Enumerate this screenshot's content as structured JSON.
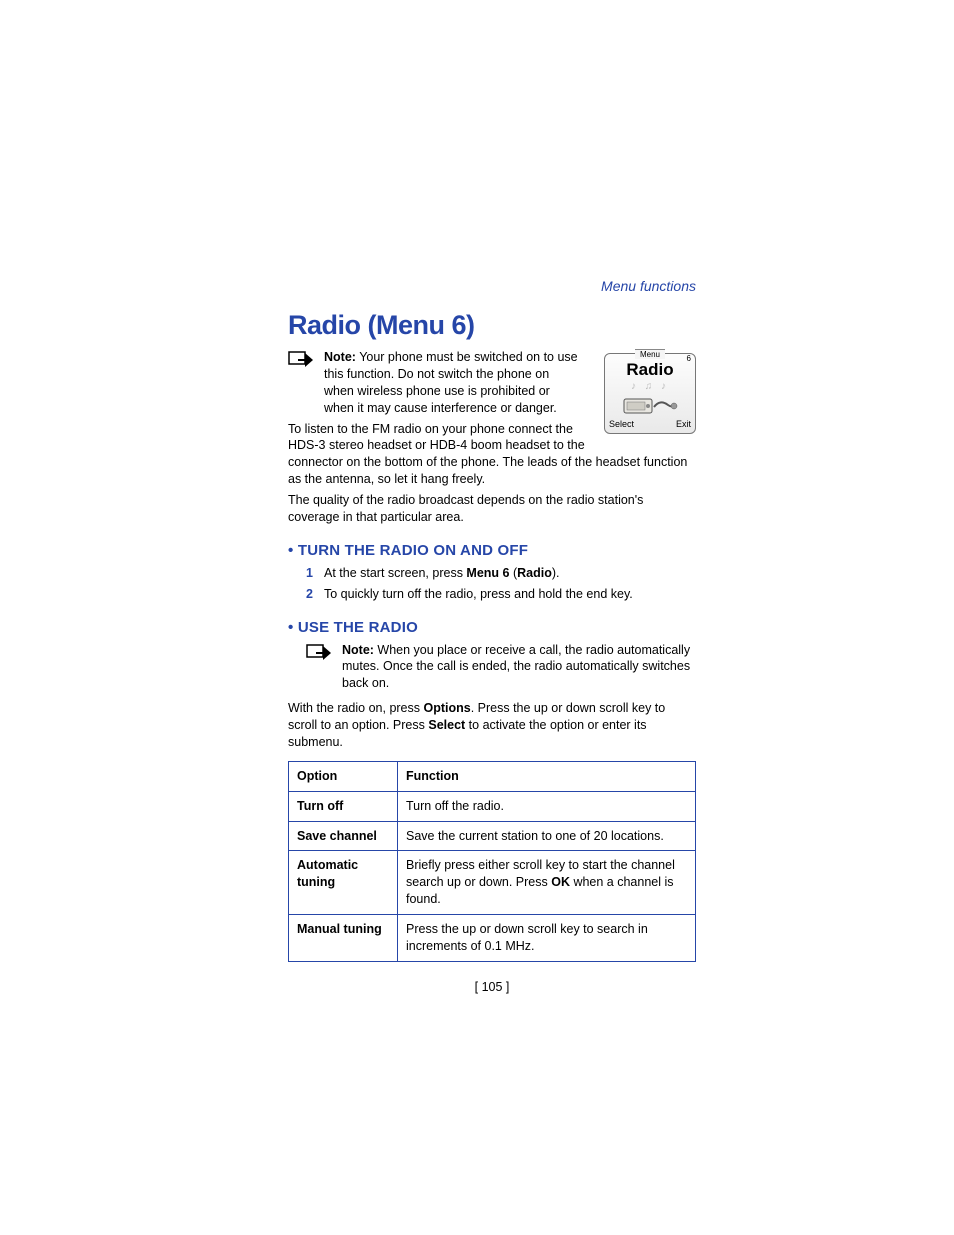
{
  "breadcrumb": "Menu functions",
  "title": "Radio (Menu 6)",
  "note1": {
    "label": "Note:",
    "text": " Your phone must be switched on to use this function. Do not switch the phone on when wireless phone use is prohibited or when it may cause interference or danger."
  },
  "phone": {
    "menu_label": "Menu",
    "menu_num": "6",
    "title": "Radio",
    "notes_glyphs": "♪ ♫ ♪",
    "left_softkey": "Select",
    "right_softkey": "Exit"
  },
  "para1": "To listen to the FM radio on your phone connect the HDS-3 stereo headset or HDB-4 boom headset to the connector on the bottom of the phone. The leads of the headset function as the antenna, so let it hang freely.",
  "para2": " The quality of the radio broadcast depends on the radio station's coverage in that particular area.",
  "section1": {
    "heading": "TURN THE RADIO ON AND OFF",
    "steps": [
      {
        "num": "1",
        "pre": "At the start screen, press ",
        "b1": "Menu 6",
        "mid": " (",
        "b2": "Radio",
        "post": ")."
      },
      {
        "num": "2",
        "pre": "To quickly turn off the radio, press and hold the end key.",
        "b1": "",
        "mid": "",
        "b2": "",
        "post": ""
      }
    ]
  },
  "section2": {
    "heading": "USE THE RADIO",
    "note": {
      "label": "Note:",
      "text": " When you place or receive a call, the radio automatically mutes. Once the call is ended, the radio automatically switches back on."
    },
    "para_pre": "With the radio on, press ",
    "para_b1": "Options",
    "para_mid": ". Press the up or down scroll key to scroll to an option. Press ",
    "para_b2": "Select",
    "para_post": " to activate the option or enter its submenu."
  },
  "table": {
    "headers": {
      "c1": "Option",
      "c2": "Function"
    },
    "rows": [
      {
        "opt": "Turn off",
        "func_pre": "Turn off the radio.",
        "func_b": "",
        "func_post": ""
      },
      {
        "opt": "Save channel",
        "func_pre": "Save the current station to one of 20 locations.",
        "func_b": "",
        "func_post": ""
      },
      {
        "opt": "Automatic tuning",
        "func_pre": "Briefly press either scroll key to start the channel search up or down. Press ",
        "func_b": "OK",
        "func_post": " when a channel is found."
      },
      {
        "opt": "Manual tuning",
        "func_pre": "Press the up or down scroll key to search in increments of 0.1 MHz.",
        "func_b": "",
        "func_post": ""
      }
    ]
  },
  "page_number": "[ 105 ]"
}
